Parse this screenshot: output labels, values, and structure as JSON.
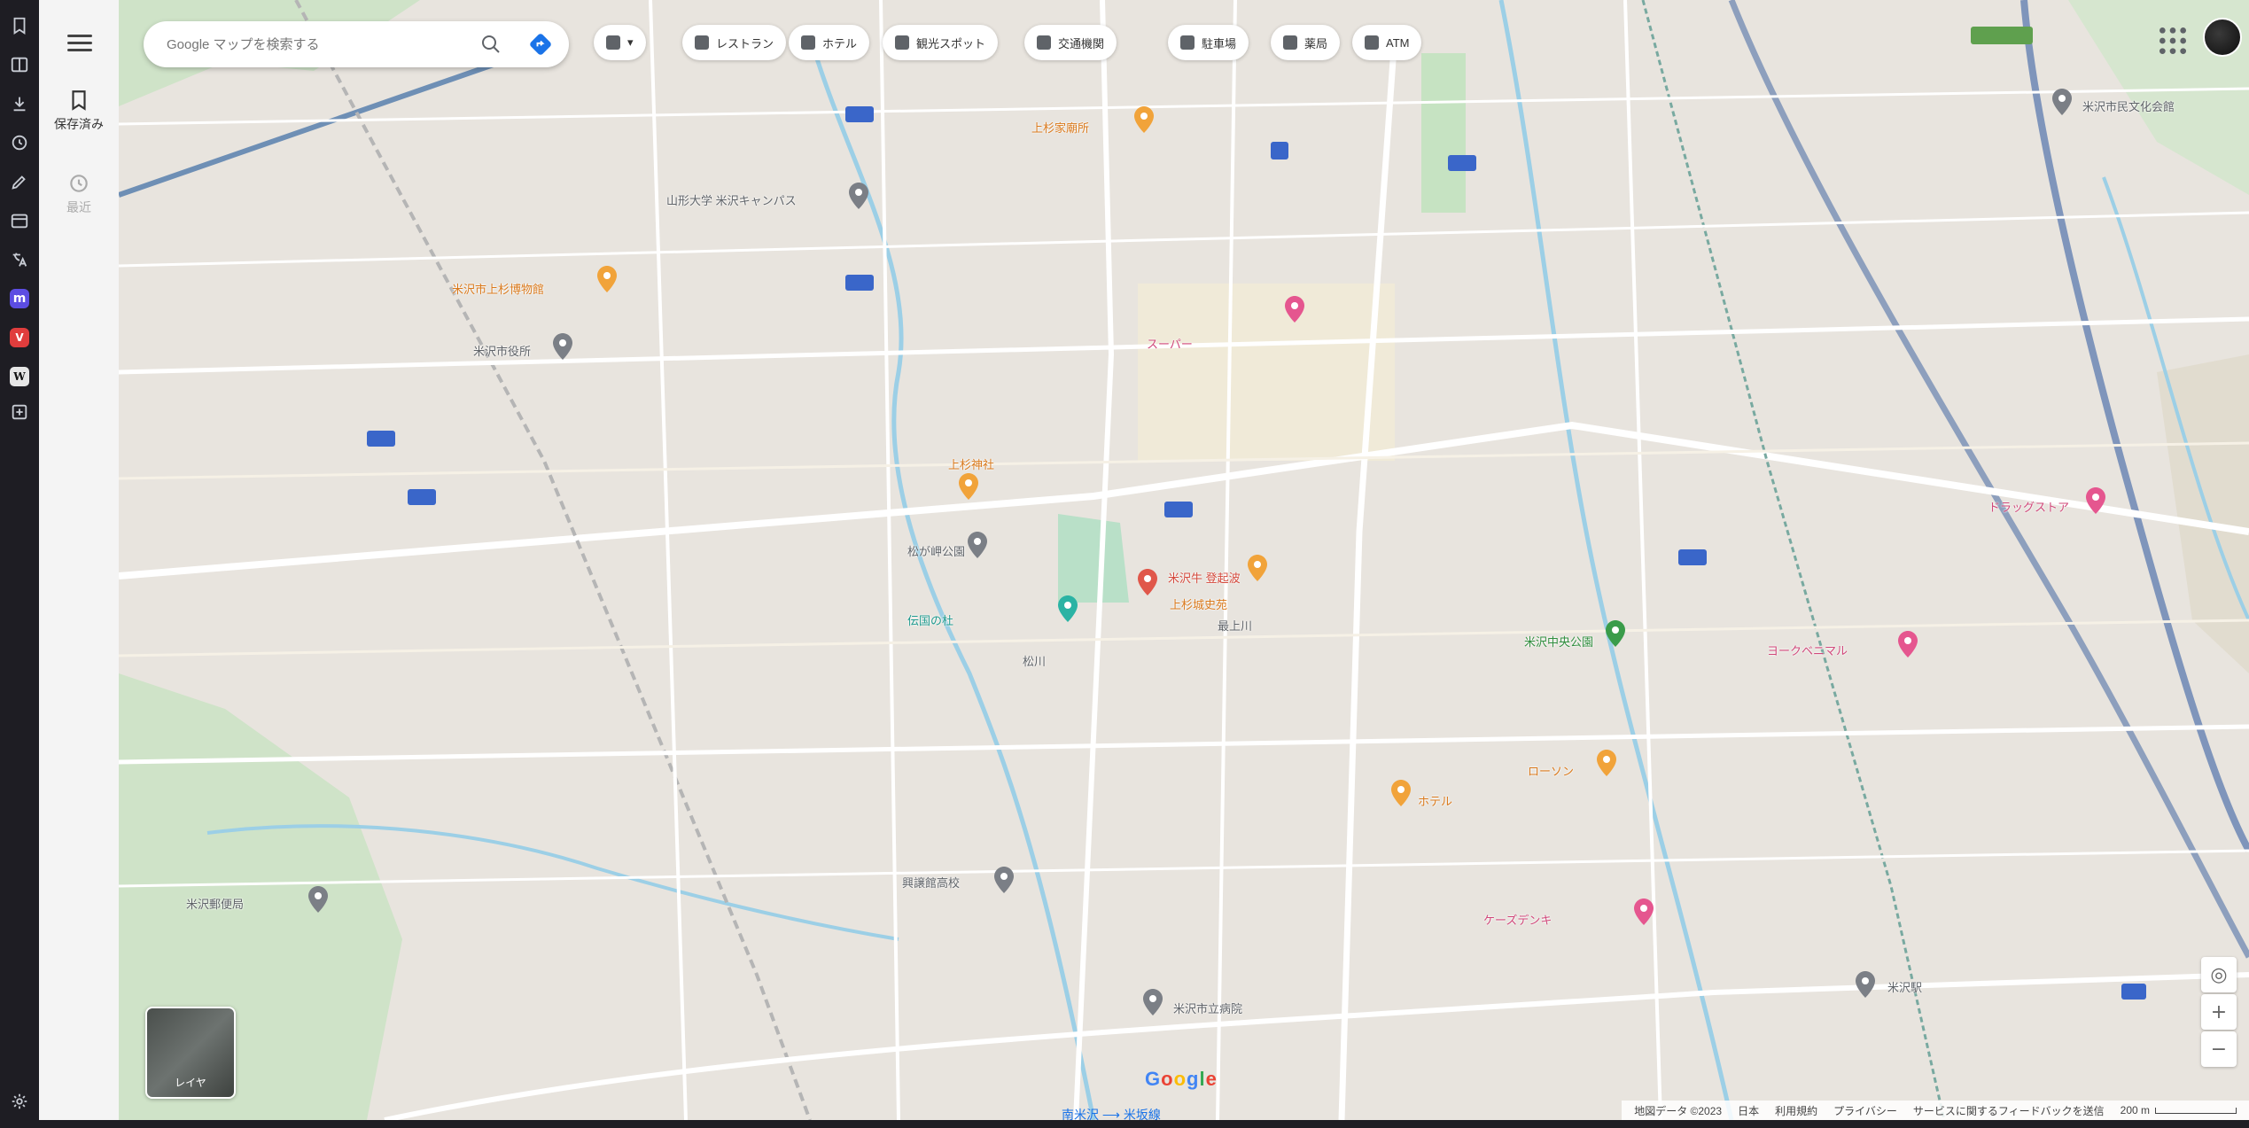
{
  "browser_panel": {
    "icons": [
      "bookmark-icon",
      "reading-list-icon",
      "downloads-icon",
      "history-icon",
      "notes-icon",
      "calendar-icon",
      "translate-icon",
      "mastodon-icon",
      "vivaldi-icon",
      "wikipedia-icon",
      "add-panel-icon",
      "settings-icon"
    ]
  },
  "rail": {
    "saved_label": "保存済み",
    "recent_label": "最近"
  },
  "search": {
    "placeholder": "Google マップを検索する"
  },
  "chips": [
    "レストラン",
    "ホテル",
    "観光スポット",
    "交通機関",
    "駐車場",
    "薬局",
    "ATM"
  ],
  "map": {
    "places": [
      {
        "name": "上杉家廟所",
        "style": "orange"
      },
      {
        "name": "山形大学 米沢キャンパス",
        "style": "grey"
      },
      {
        "name": "米沢市役所",
        "style": "grey"
      },
      {
        "name": "上杉神社",
        "style": "orange"
      },
      {
        "name": "松が岬公園",
        "style": "grey"
      },
      {
        "name": "米沢市上杉博物館",
        "style": "orange"
      },
      {
        "name": "伝国の杜",
        "style": "teal"
      },
      {
        "name": "米沢牛 登起波",
        "style": "red"
      },
      {
        "name": "上杉城史苑",
        "style": "orange"
      },
      {
        "name": "米沢駅",
        "style": "grey"
      },
      {
        "name": "ヨークベニマル",
        "style": "pink"
      },
      {
        "name": "ホテル",
        "style": "orange"
      },
      {
        "name": "米沢市立病院",
        "style": "grey"
      },
      {
        "name": "ケーズデンキ",
        "style": "pink"
      },
      {
        "name": "ローソン",
        "style": "orange"
      },
      {
        "name": "松川",
        "style": "grey"
      },
      {
        "name": "最上川",
        "style": "grey"
      },
      {
        "name": "興譲館高校",
        "style": "grey"
      },
      {
        "name": "米沢郵便局",
        "style": "grey"
      },
      {
        "name": "米沢中央公園",
        "style": "green"
      },
      {
        "name": "スーパー",
        "style": "pink"
      },
      {
        "name": "ドラッグストア",
        "style": "pink"
      },
      {
        "name": "米沢市民文化会館",
        "style": "grey"
      }
    ],
    "station_label": "南米沢 ⟶ 米坂線",
    "layers_label": "レイヤ"
  },
  "footer": {
    "map_data": "地図データ ©2023",
    "country": "日本",
    "terms": "利用規約",
    "privacy": "プライバシー",
    "feedback": "サービスに関するフィードバックを送信",
    "scale": "200 m"
  },
  "colors": {
    "orange_pin": "#f1a33a",
    "pink_pin": "#e5568f",
    "red_pin": "#e0574a",
    "teal_pin": "#2bb3a4",
    "grey_pin": "#7b7f86",
    "road": "#ffffff",
    "river": "#9ccfe6"
  }
}
